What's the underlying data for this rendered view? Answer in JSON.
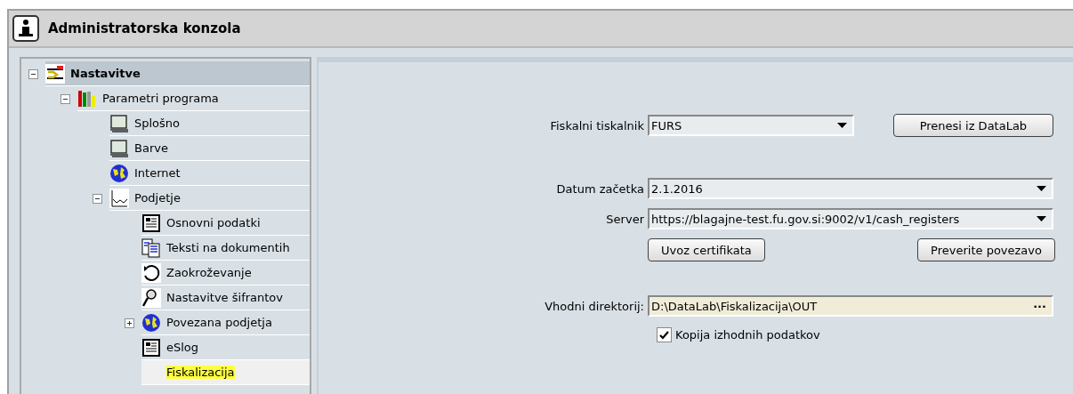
{
  "window": {
    "title": "Administratorska konzola"
  },
  "tree": [
    {
      "label": "Nastavitve",
      "kind": "settings",
      "expanded": true,
      "selected": false,
      "children": [
        {
          "label": "Parametri programa",
          "kind": "books",
          "expanded": true,
          "selected": false,
          "children": [
            {
              "label": "Splošno",
              "kind": "monitor",
              "selected": false
            },
            {
              "label": "Barve",
              "kind": "monitor",
              "selected": false
            },
            {
              "label": "Internet",
              "kind": "globe",
              "selected": false
            },
            {
              "label": "Podjetje",
              "kind": "chart",
              "expanded": true,
              "selected": false,
              "children": [
                {
                  "label": "Osnovni podatki",
                  "kind": "doc",
                  "selected": false
                },
                {
                  "label": "Teksti na dokumentih",
                  "kind": "docs",
                  "selected": false
                },
                {
                  "label": "Zaokroževanje",
                  "kind": "circle",
                  "selected": false
                },
                {
                  "label": "Nastavitve šifrantov",
                  "kind": "magnifier",
                  "selected": false
                },
                {
                  "label": "Povezana podjetja",
                  "kind": "globe",
                  "expanded": false,
                  "selected": false
                },
                {
                  "label": "eSlog",
                  "kind": "doc",
                  "selected": false
                },
                {
                  "label": "Fiskalizacija",
                  "kind": "plain",
                  "selected": true
                }
              ]
            }
          ]
        }
      ]
    }
  ],
  "form": {
    "printer": {
      "label": "Fiskalni tiskalnik",
      "value": "FURS"
    },
    "transfer_button": "Prenesi iz DataLab",
    "start_date": {
      "label": "Datum začetka",
      "value": "2.1.2016"
    },
    "server": {
      "label": "Server",
      "value": "https://blagajne-test.fu.gov.si:9002/v1/cash_registers"
    },
    "import_button": "Uvoz certifikata",
    "check_button": "Preverite povezavo",
    "input_dir": {
      "label": "Vhodni direktorij:",
      "value": "D:\\DataLab\\Fiskalizacija\\OUT",
      "browse": "···"
    },
    "copy_output": {
      "label": "Kopija izhodnih podatkov",
      "checked": true
    }
  }
}
